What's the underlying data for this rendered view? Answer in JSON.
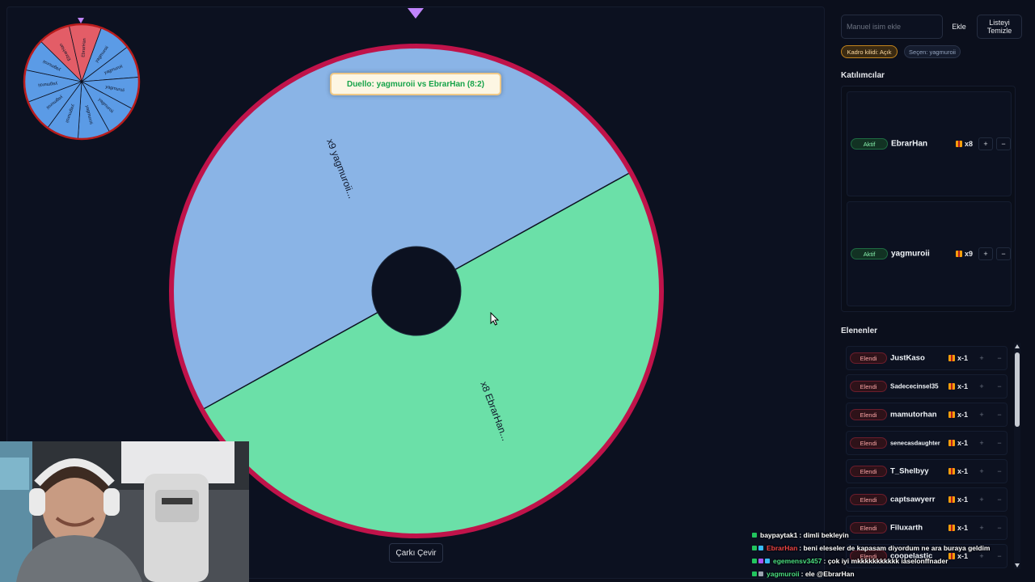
{
  "duel_banner": "Duello: yagmuroii vs EbrarHan (8:2)",
  "spin_button": "Çarkı Çevir",
  "main_wheel": {
    "segments": [
      {
        "label": "x9 yagmuroii...",
        "color": "#8ab4e6"
      },
      {
        "label": "x8 EbrarHan...",
        "color": "#6be0a8"
      }
    ],
    "rim_color": "#c0134a",
    "hub_color": "#0c1120"
  },
  "mini_wheel": {
    "labels": [
      "yagmuroii",
      "yagmuroii",
      "yagmuroii",
      "yagmuroii",
      "yagmuroii",
      "yagmuroii",
      "yagmuroii",
      "yagmuroii",
      "yagmuroii",
      "EbrarHan",
      "EbrarHan"
    ],
    "label_colors": [
      "#5b9be6",
      "#e35d67"
    ]
  },
  "side_panel": {
    "manual_input_placeholder": "Manuel isim ekle",
    "add_button": "Ekle",
    "clear_list_button": "Listeyi Temizle",
    "roster_lock": "Kadro kilidi: Açık",
    "chooser": "Seçen: yagmuroii",
    "participants_title": "Katılımcılar",
    "participants": [
      {
        "status": "Aktif",
        "name": "EbrarHan",
        "count": "x8",
        "plus": "+",
        "minus": "−"
      },
      {
        "status": "Aktif",
        "name": "yagmuroii",
        "count": "x9",
        "plus": "+",
        "minus": "−"
      }
    ],
    "eliminated_title": "Elenenler",
    "eliminated": [
      {
        "status": "Elendi",
        "name": "JustKaso",
        "count": "x-1",
        "plus": "+",
        "minus": "−"
      },
      {
        "status": "Elendi",
        "name": "Sadececinsel35",
        "count": "x-1",
        "plus": "+",
        "minus": "−"
      },
      {
        "status": "Elendi",
        "name": "mamutorhan",
        "count": "x-1",
        "plus": "+",
        "minus": "−"
      },
      {
        "status": "Elendi",
        "name": "senecasdaughter",
        "count": "x-1",
        "plus": "+",
        "minus": "−"
      },
      {
        "status": "Elendi",
        "name": "T_Shelbyy",
        "count": "x-1",
        "plus": "+",
        "minus": "−"
      },
      {
        "status": "Elendi",
        "name": "captsawyerr",
        "count": "x-1",
        "plus": "+",
        "minus": "−"
      },
      {
        "status": "Elendi",
        "name": "Filuxarth",
        "count": "x-1",
        "plus": "+",
        "minus": "−"
      },
      {
        "status": "Elendi",
        "name": "coopelastic",
        "count": "x-1",
        "plus": "+",
        "minus": "−"
      }
    ]
  },
  "chat": [
    {
      "user": "baypaytak1",
      "user_color": "#ffffff",
      "badge_colors": [
        "#22c55e"
      ],
      "text": ": dimli bekleyin"
    },
    {
      "user": "EbrarHan",
      "user_color": "#ef4444",
      "badge_colors": [
        "#22c55e",
        "#38bdf8"
      ],
      "text": ": beni eleseler de kapasam diyordum ne ara buraya geldim"
    },
    {
      "user": "egemensv3457",
      "user_color": "#4ade80",
      "badge_colors": [
        "#22c55e",
        "#a855f7",
        "#38bdf8"
      ],
      "text": ": çok iyi mkkkkkkkkkkk iaselonffnader"
    },
    {
      "user": "yagmuroii",
      "user_color": "#4ade80",
      "badge_colors": [
        "#22c55e",
        "#9ca3af"
      ],
      "text": ": ele @EbrarHan"
    }
  ]
}
